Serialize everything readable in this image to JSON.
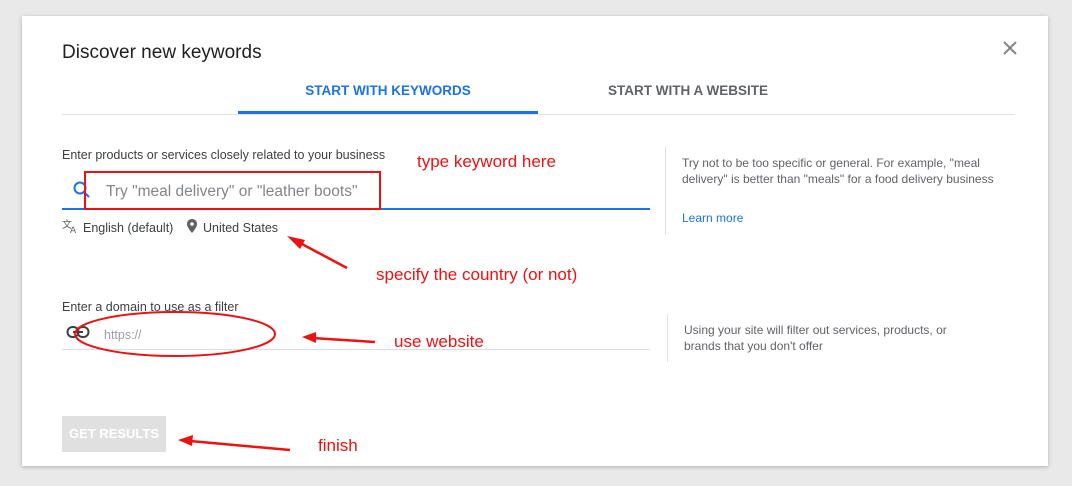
{
  "dialog": {
    "title": "Discover new keywords",
    "tabs": [
      {
        "label": "START WITH KEYWORDS",
        "active": true
      },
      {
        "label": "START WITH A WEBSITE",
        "active": false
      }
    ]
  },
  "keywords": {
    "label": "Enter products or services closely related to your business",
    "placeholder": "Try \"meal delivery\" or \"leather boots\"",
    "language": "English (default)",
    "location": "United States",
    "help_text": "Try not to be too specific or general. For example, \"meal delivery\" is better than \"meals\" for a food delivery business",
    "learn_more": "Learn more"
  },
  "domain": {
    "label": "Enter a domain to use as a filter",
    "placeholder": "https://",
    "help_text": "Using your site will filter out services, products, or brands that you don't offer"
  },
  "actions": {
    "get_results": "GET RESULTS"
  },
  "annotations": {
    "type_keyword": "type keyword here",
    "specify_country": "specify the country (or not)",
    "use_website": "use website",
    "finish": "finish"
  },
  "colors": {
    "accent": "#1a73e8",
    "annotation": "#ee1111"
  }
}
